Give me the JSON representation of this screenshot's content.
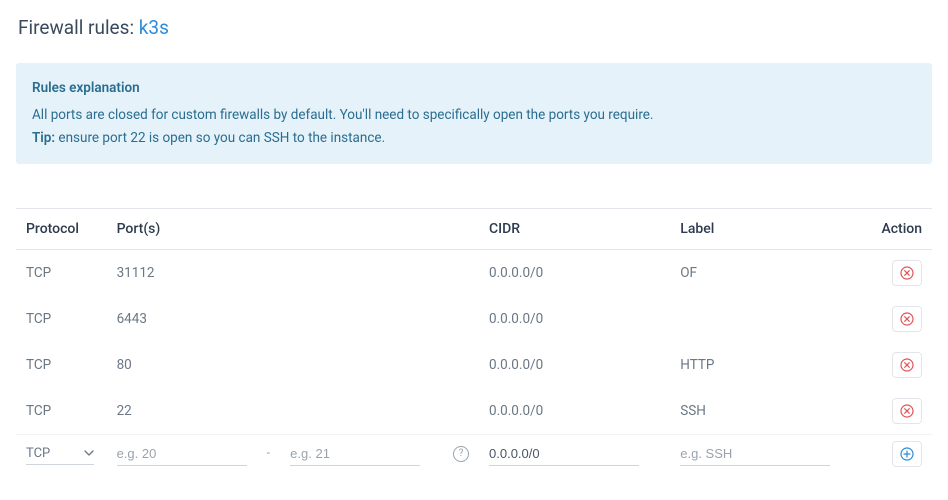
{
  "title_prefix": "Firewall rules: ",
  "title_name": "k3s",
  "explanation": {
    "heading": "Rules explanation",
    "body": "All ports are closed for custom firewalls by default. You'll need to specifically open the ports you require.",
    "tip_label": "Tip:",
    "tip_body": " ensure port 22 is open so you can SSH to the instance."
  },
  "headers": {
    "protocol": "Protocol",
    "ports": "Port(s)",
    "cidr": "CIDR",
    "label": "Label",
    "action": "Action"
  },
  "rules": [
    {
      "protocol": "TCP",
      "ports": "31112",
      "cidr": "0.0.0.0/0",
      "label": "OF"
    },
    {
      "protocol": "TCP",
      "ports": "6443",
      "cidr": "0.0.0.0/0",
      "label": ""
    },
    {
      "protocol": "TCP",
      "ports": "80",
      "cidr": "0.0.0.0/0",
      "label": "HTTP"
    },
    {
      "protocol": "TCP",
      "ports": "22",
      "cidr": "0.0.0.0/0",
      "label": "SSH"
    }
  ],
  "new_rule": {
    "protocol": "TCP",
    "port_start_placeholder": "e.g. 20",
    "port_end_placeholder": "e.g. 21",
    "cidr_value": "0.0.0.0/0",
    "label_placeholder": "e.g. SSH"
  }
}
